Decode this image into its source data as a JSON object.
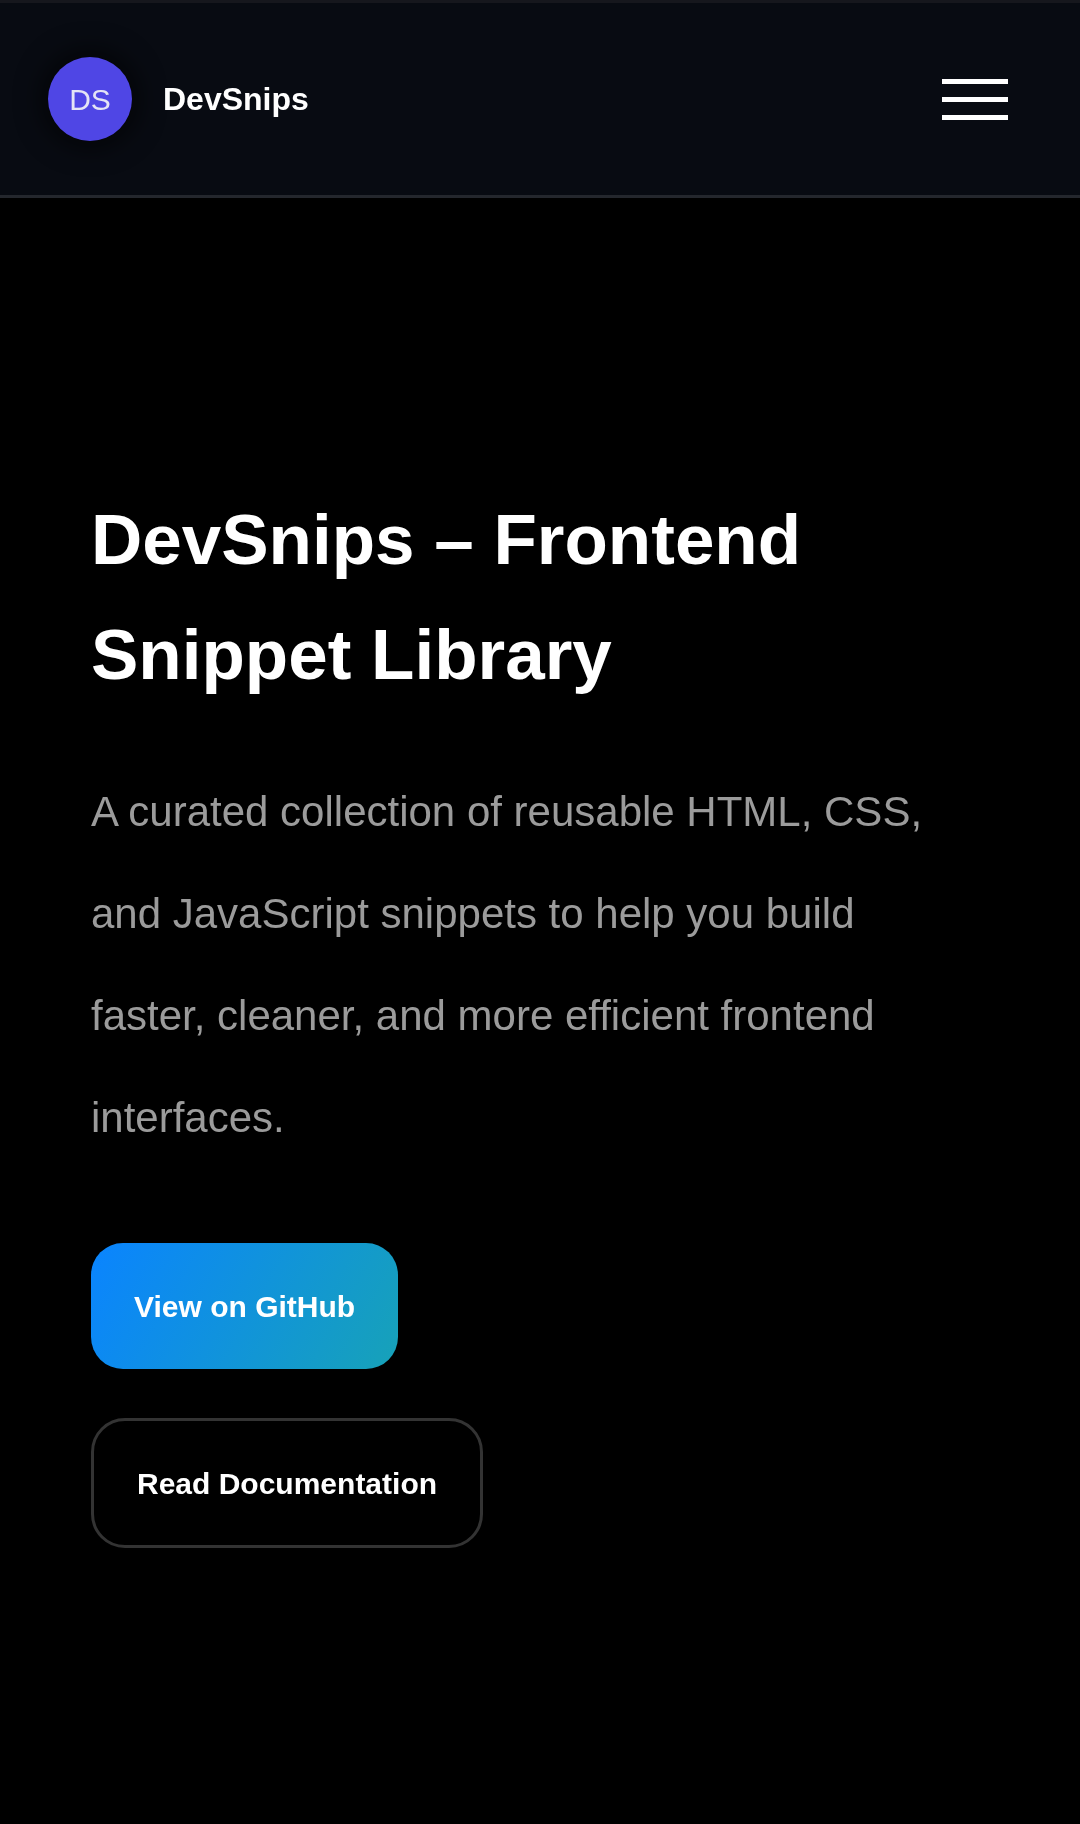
{
  "header": {
    "logo_initials": "DS",
    "brand": "DevSnips"
  },
  "hero": {
    "title": "DevSnips – Frontend Snippet Library",
    "description": "A curated collection of reusable HTML, CSS, and JavaScript snippets to help you build faster, cleaner, and more efficient frontend interfaces.",
    "buttons": [
      {
        "label": "View on GitHub",
        "kind": "primary"
      },
      {
        "label": "Read Documentation",
        "kind": "outline"
      }
    ]
  }
}
